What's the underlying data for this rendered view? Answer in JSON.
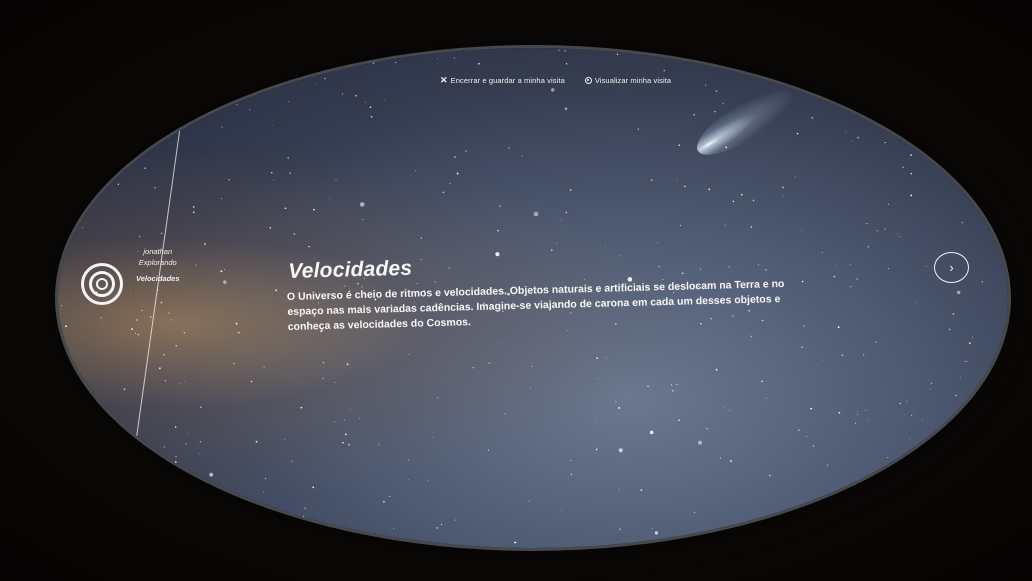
{
  "top_bar": {
    "end_visit": {
      "icon": "close-icon",
      "label": "Encerrar e guardar a minha visita"
    },
    "view_visit": {
      "icon": "eye-icon",
      "label": "Visualizar minha visita"
    }
  },
  "user": {
    "icon": "profile-rings-icon",
    "name": "jonathan",
    "status": "Explorando",
    "section": "Velocidades"
  },
  "main": {
    "title": "Velocidades",
    "description": "O Universo é cheio de ritmos e velocidades. Objetos naturais e artificiais se deslocam na Terra e no espaço nas mais variadas cadências. Imagine-se viajando de carona em cada um desses objetos e conheça as velocidades do Cosmos."
  },
  "navigation": {
    "next_icon": "chevron-right-icon",
    "next_glyph": "›"
  },
  "colors": {
    "text": "#f7f7f7",
    "sky": "#4e5a72",
    "frame": "#0b0807"
  }
}
